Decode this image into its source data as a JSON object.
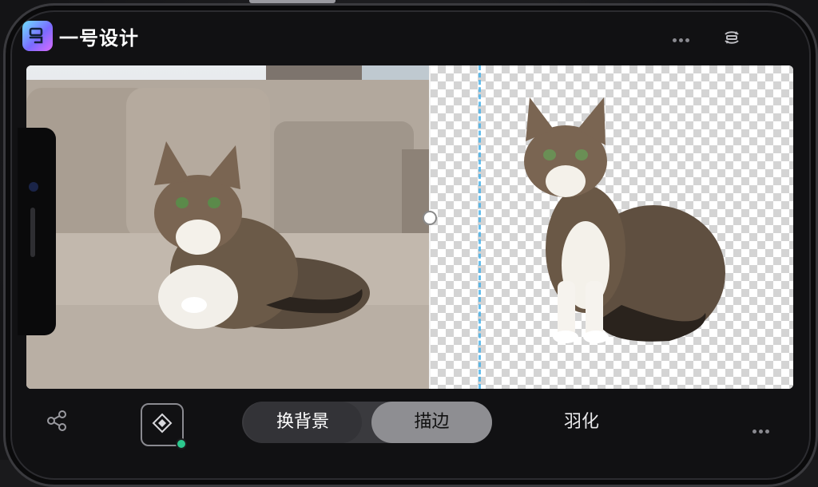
{
  "app": {
    "title": "一号设计",
    "logo_icon": "app-logo-icon",
    "accent": "#7a6bff"
  },
  "header": {
    "more_icon": "more-horizontal-icon",
    "rotate_icon": "rotate-icon"
  },
  "canvas": {
    "left_label": "original-photo",
    "right_label": "cutout-preview",
    "divider_handle_icon": "split-handle-icon"
  },
  "toolbar": {
    "share_icon": "share-icon",
    "magic_icon": "magic-select-icon",
    "tabs": [
      {
        "label": "换背景",
        "selected": false
      },
      {
        "label": "描边",
        "selected": true
      },
      {
        "label": "羽化",
        "selected": false
      }
    ],
    "more_icon": "more-horizontal-icon"
  }
}
